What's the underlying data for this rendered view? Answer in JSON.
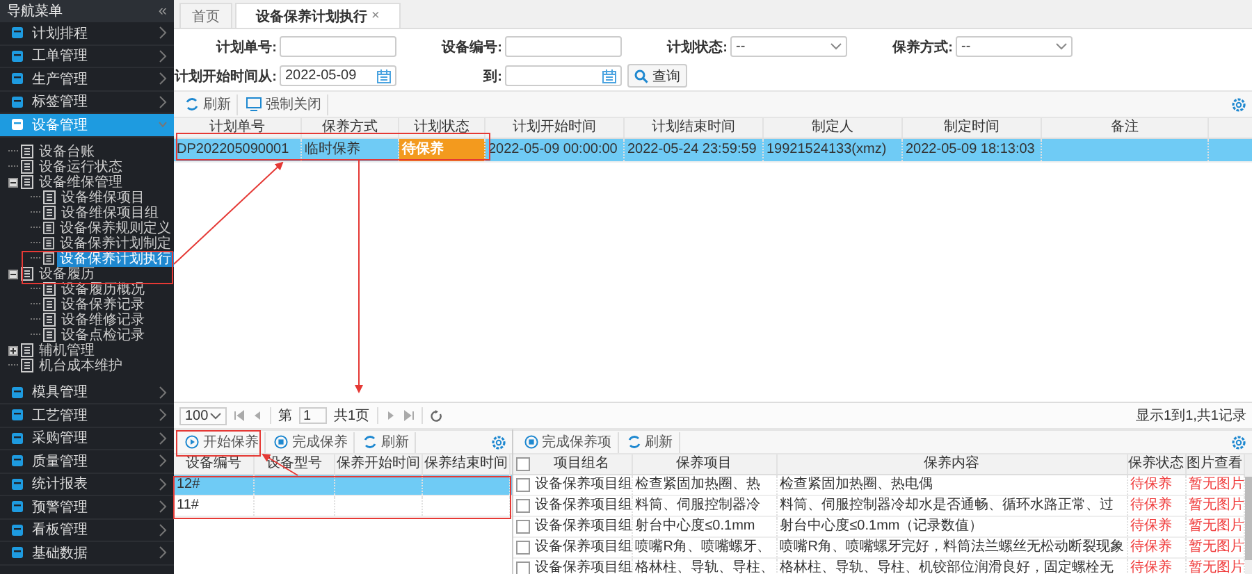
{
  "sidebar": {
    "title": "导航菜单",
    "collapse_glyph": "«",
    "menu": [
      {
        "label": "计划排程",
        "selected": false,
        "expanded": false
      },
      {
        "label": "工单管理",
        "selected": false,
        "expanded": false
      },
      {
        "label": "生产管理",
        "selected": false,
        "expanded": false
      },
      {
        "label": "标签管理",
        "selected": false,
        "expanded": false
      },
      {
        "label": "设备管理",
        "selected": true,
        "expanded": true,
        "children": [
          {
            "label": "设备台账",
            "selected": false
          },
          {
            "label": "设备运行状态",
            "selected": false
          },
          {
            "label": "设备维保管理",
            "selected": false,
            "expanded": true,
            "children": [
              {
                "label": "设备维保项目",
                "selected": false
              },
              {
                "label": "设备维保项目组",
                "selected": false
              },
              {
                "label": "设备保养规则定义",
                "selected": false
              },
              {
                "label": "设备保养计划制定",
                "selected": false
              },
              {
                "label": "设备保养计划执行",
                "selected": true
              }
            ]
          },
          {
            "label": "设备履历",
            "selected": false,
            "expanded": true,
            "children": [
              {
                "label": "设备履历概况",
                "selected": false
              },
              {
                "label": "设备保养记录",
                "selected": false
              },
              {
                "label": "设备维修记录",
                "selected": false
              },
              {
                "label": "设备点检记录",
                "selected": false
              }
            ]
          },
          {
            "label": "辅机管理",
            "selected": false,
            "expanded": false
          },
          {
            "label": "机台成本维护",
            "selected": false
          }
        ]
      },
      {
        "label": "模具管理",
        "selected": false,
        "expanded": false
      },
      {
        "label": "工艺管理",
        "selected": false,
        "expanded": false
      },
      {
        "label": "采购管理",
        "selected": false,
        "expanded": false
      },
      {
        "label": "质量管理",
        "selected": false,
        "expanded": false
      },
      {
        "label": "统计报表",
        "selected": false,
        "expanded": false
      },
      {
        "label": "预警管理",
        "selected": false,
        "expanded": false
      },
      {
        "label": "看板管理",
        "selected": false,
        "expanded": false
      },
      {
        "label": "基础数据",
        "selected": false,
        "expanded": false
      }
    ]
  },
  "tabs": [
    {
      "label": "首页",
      "selected": false
    },
    {
      "label": "设备保养计划执行",
      "selected": true,
      "close_glyph": "×"
    }
  ],
  "filters": [
    {
      "label": "计划单号:",
      "kind": "text"
    },
    {
      "label": "设备编号:",
      "kind": "text"
    },
    {
      "label": "计划状态:",
      "kind": "select",
      "value": "--"
    },
    {
      "label": "保养方式:",
      "kind": "select",
      "value": "--"
    },
    {
      "label": "计划开始时间从:",
      "kind": "date",
      "value": "2022-05-09"
    },
    {
      "label": "到:",
      "kind": "date"
    }
  ],
  "search_button": "查询",
  "toolbar": [
    {
      "label": "刷新",
      "kind": "refresh"
    },
    {
      "label": "强制关闭",
      "kind": "monitor"
    }
  ],
  "plan_table": {
    "columns": [
      "计划单号",
      "保养方式",
      "计划状态",
      "计划开始时间",
      "计划结束时间",
      "制定人",
      "制定时间",
      "备注"
    ],
    "rows": [
      {
        "selected": true,
        "cells": [
          "DP202205090001",
          "临时保养",
          "待保养",
          "2022-05-09 00:00:00",
          "2022-05-24 23:59:59",
          "19921524133(xmz)",
          "2022-05-09 18:13:03"
        ]
      }
    ]
  },
  "pager": {
    "page_size": "100",
    "page_label": "第",
    "page": "1",
    "total_pages": "共1页",
    "summary": "显示1到1,共1记录"
  },
  "equipment_panel": {
    "toolbar": [
      {
        "label": "开始保养",
        "kind": "start"
      },
      {
        "label": "完成保养",
        "kind": "finish"
      },
      {
        "label": "刷新",
        "kind": "refresh"
      }
    ],
    "columns": [
      "设备编号",
      "设备型号",
      "保养开始时间",
      "保养结束时间"
    ],
    "rows": [
      {
        "selected": true,
        "cells": [
          "12#"
        ]
      },
      {
        "selected": false,
        "cells": [
          "11#"
        ]
      }
    ]
  },
  "items_panel": {
    "toolbar": [
      {
        "label": "完成保养项",
        "kind": "finish"
      },
      {
        "label": "刷新",
        "kind": "refresh"
      }
    ],
    "all_checked": false,
    "columns": [
      "项目组名",
      "保养项目",
      "保养内容",
      "保养状态",
      "图片查看"
    ],
    "rows": [
      {
        "checked": false,
        "cells": [
          "设备保养项目组",
          "检查紧固加热圈、热",
          "检查紧固加热圈、热电偶",
          "待保养",
          "暂无图片"
        ]
      },
      {
        "checked": false,
        "cells": [
          "设备保养项目组",
          "料筒、伺服控制器冷",
          "料筒、伺服控制器冷却水是否通畅、循环水路正常、过",
          "待保养",
          "暂无图片"
        ]
      },
      {
        "checked": false,
        "cells": [
          "设备保养项目组",
          "射台中心度≤0.1mm",
          "射台中心度≤0.1mm（记录数值）",
          "待保养",
          "暂无图片"
        ]
      },
      {
        "checked": false,
        "cells": [
          "设备保养项目组",
          "喷嘴R角、喷嘴螺牙、",
          "喷嘴R角、喷嘴螺牙完好，料筒法兰螺丝无松动断裂现象",
          "待保养",
          "暂无图片"
        ]
      },
      {
        "checked": false,
        "cells": [
          "设备保养项目组",
          "格林柱、导轨、导柱、",
          "格林柱、导轨、导柱、机铰部位润滑良好，固定螺栓无",
          "待保养",
          "暂无图片"
        ]
      }
    ]
  }
}
